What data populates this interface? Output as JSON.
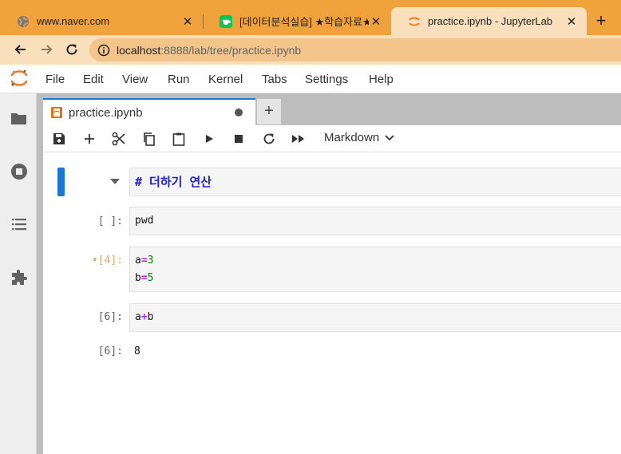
{
  "browser": {
    "tabs": [
      {
        "title": "www.naver.com",
        "icon": "globe-icon",
        "close": "✕"
      },
      {
        "title": "[데이터분석실습] ★학습자료★ -",
        "icon": "naver-cafe-icon",
        "close": "✕"
      },
      {
        "title": "practice.ipynb - JupyterLab",
        "icon": "jupyter-icon",
        "close": "✕",
        "active": true
      }
    ],
    "new_tab": "+",
    "url_host": "localhost",
    "url_path": ":8888/lab/tree/practice.ipynb"
  },
  "menu": [
    "File",
    "Edit",
    "View",
    "Run",
    "Kernel",
    "Tabs",
    "Settings",
    "Help"
  ],
  "notebook": {
    "tab_title": "practice.ipynb",
    "add_tab": "+",
    "cell_type": "Markdown",
    "cells": [
      {
        "type": "markdown",
        "prompt": "",
        "source": "# 더하기 연산"
      },
      {
        "type": "code",
        "prompt": "[ ]:",
        "source": [
          "pwd"
        ]
      },
      {
        "type": "code",
        "prompt": "•[4]:",
        "source": [
          "a=3",
          "b=5"
        ]
      },
      {
        "type": "code",
        "prompt": "[6]:",
        "source": [
          "a+b"
        ]
      },
      {
        "type": "output",
        "prompt": "[6]:",
        "text": "8"
      }
    ]
  },
  "colors": {
    "chrome_tabstrip": "#f0a23c",
    "chrome_active": "#f9dfbc",
    "omnibox": "#f3c58b",
    "jupyter_blue": "#1976d2",
    "jupyter_orange": "#f37726"
  }
}
